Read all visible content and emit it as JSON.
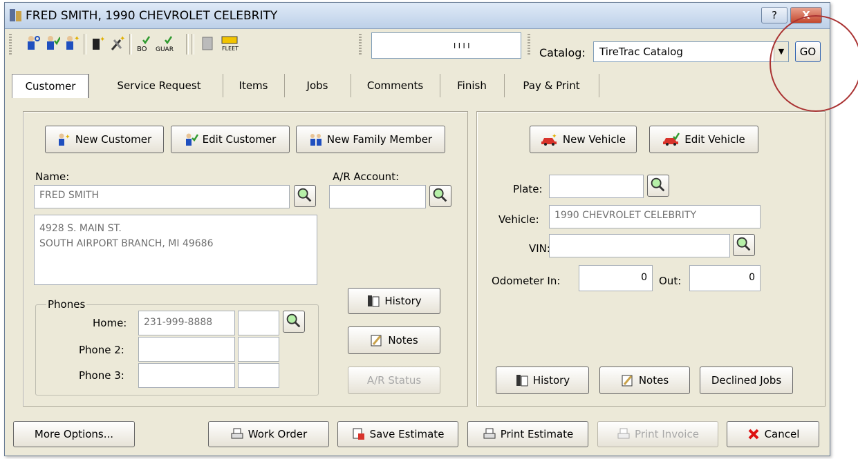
{
  "window": {
    "title": "FRED SMITH, 1990 CHEVROLET CELEBRITY",
    "help_button": "?",
    "close_button": "X"
  },
  "toolbar": {
    "meter_text": "I  I I I",
    "bo_label": "BO",
    "guar_label": "GUAR",
    "fleet_label": "FLEET",
    "catalog_label": "Catalog:",
    "catalog_value": "TireTrac Catalog",
    "go_label": "GO"
  },
  "tabs": [
    "Customer",
    "Service Request",
    "Items",
    "Jobs",
    "Comments",
    "Finish",
    "Pay & Print"
  ],
  "customer": {
    "new_customer": "New Customer",
    "edit_customer": "Edit Customer",
    "new_family_member": "New Family Member",
    "name_label": "Name:",
    "name_value": "FRED SMITH",
    "ar_label": "A/R Account:",
    "ar_value": "",
    "address_line1": "4928 S. MAIN ST.",
    "address_line2": "SOUTH AIRPORT BRANCH, MI  49686",
    "phones_label": "Phones",
    "home_label": "Home:",
    "home_value": "231-999-8888",
    "phone2_label": "Phone 2:",
    "phone3_label": "Phone 3:",
    "history": "History",
    "notes": "Notes",
    "ar_status": "A/R Status"
  },
  "vehicle": {
    "new_vehicle": "New Vehicle",
    "edit_vehicle": "Edit Vehicle",
    "plate_label": "Plate:",
    "plate_value": "",
    "vehicle_label": "Vehicle:",
    "vehicle_value": "1990 CHEVROLET CELEBRITY",
    "vin_label": "VIN:",
    "vin_value": "",
    "odometer_in_label": "Odometer In:",
    "odometer_in_value": "0",
    "out_label": "Out:",
    "out_value": "0",
    "history": "History",
    "notes": "Notes",
    "declined_jobs": "Declined Jobs"
  },
  "footer": {
    "more_options": "More Options...",
    "work_order": "Work Order",
    "save_estimate": "Save Estimate",
    "print_estimate": "Print Estimate",
    "print_invoice": "Print Invoice",
    "cancel": "Cancel"
  },
  "colors": {
    "window_bg": "#ece9d8",
    "title_gradient_top": "#dfeaf7",
    "close_red": "#c4472c",
    "annotation_red": "#aa3333",
    "person_blue": "#1f4fbf",
    "check_green": "#2f9a2f"
  }
}
